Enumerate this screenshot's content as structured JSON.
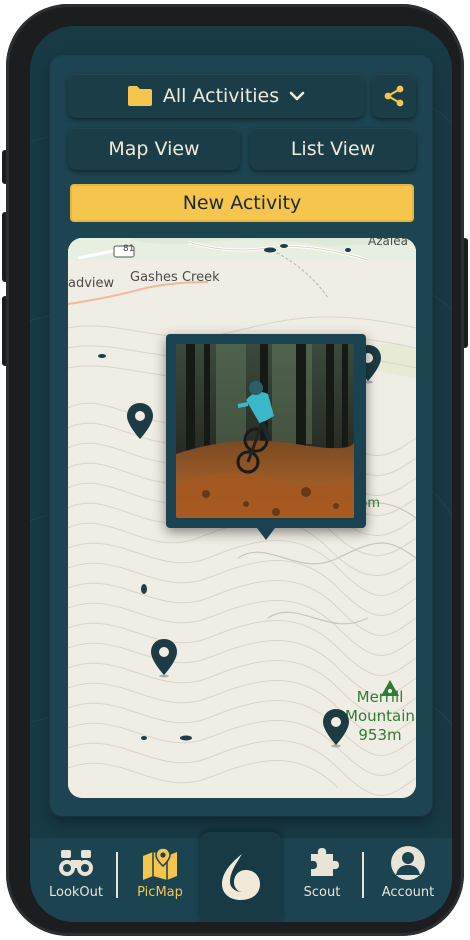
{
  "header": {
    "filter_label": "All Activities",
    "map_view_label": "Map View",
    "list_view_label": "List View",
    "new_activity_label": "New Activity"
  },
  "map": {
    "labels": {
      "road_number": "81",
      "place_1": "Gashes Creek",
      "place_2": "adview",
      "place_3": "Azalea",
      "ghost_text": "5p..., 5oom"
    },
    "mountain": {
      "name_line1": "Merrill",
      "name_line2": "Mountain",
      "elevation": "953m"
    },
    "popup": {
      "image_description_icon": "photo-icon"
    },
    "pin_count": 4
  },
  "nav": {
    "items": [
      {
        "label": "LookOut",
        "icon": "binoculars-icon"
      },
      {
        "label": "PicMap",
        "icon": "folded-map-pin-icon",
        "active": true
      },
      {
        "label": "",
        "icon": "app-logo-icon"
      },
      {
        "label": "Scout",
        "icon": "puzzle-icon"
      },
      {
        "label": "Account",
        "icon": "user-avatar-icon"
      }
    ]
  },
  "colors": {
    "accent": "#f6c54e",
    "panel": "#1d4451",
    "pin": "#1c3b45",
    "mountain_green": "#2e7d32"
  }
}
